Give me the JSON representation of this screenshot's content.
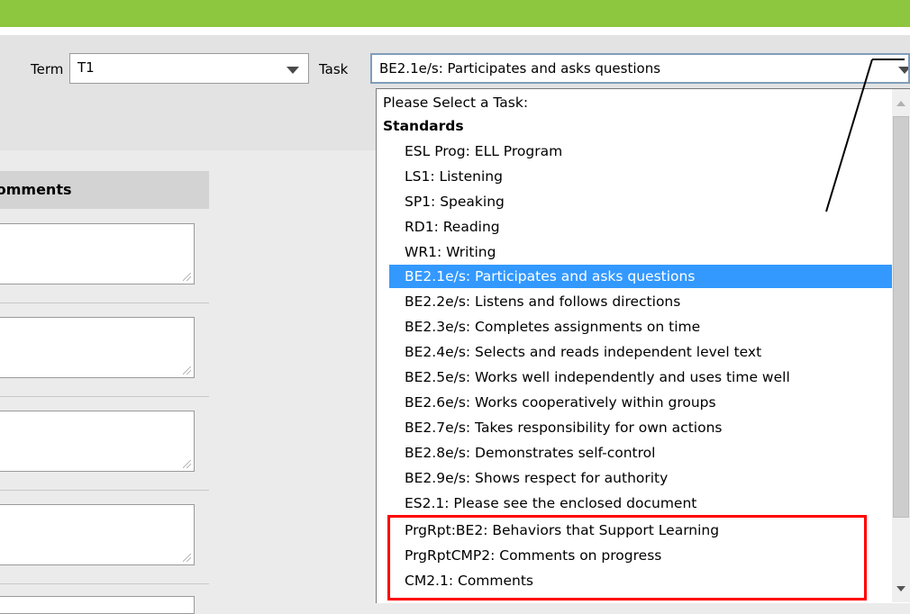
{
  "filters": {
    "term_label": "Term",
    "term_value": "T1",
    "task_label": "Task",
    "task_value": "BE2.1e/s: Participates and asks questions"
  },
  "comments": {
    "header": "Comments"
  },
  "dropdown": {
    "placeholder": "Please Select a Task:",
    "group": "Standards",
    "items": [
      "ESL Prog: ELL Program",
      "LS1: Listening",
      "SP1: Speaking",
      "RD1: Reading",
      "WR1: Writing",
      "BE2.1e/s: Participates and asks questions",
      "BE2.2e/s: Listens and follows directions",
      "BE2.3e/s: Completes assignments on time",
      "BE2.4e/s: Selects and reads independent level text",
      "BE2.5e/s: Works well independently and uses time well",
      "BE2.6e/s: Works cooperatively within groups",
      "BE2.7e/s: Takes responsibility for own actions",
      "BE2.8e/s: Demonstrates self-control",
      "BE2.9e/s: Shows respect for authority",
      "ES2.1: Please see the enclosed document",
      "PrgRpt:BE2: Behaviors that Support Learning",
      "PrgRptCMP2: Comments on progress",
      "CM2.1: Comments"
    ],
    "selected_index": 5
  },
  "colors": {
    "topbar": "#8dc63f",
    "selection": "#3399ff",
    "highlight_box": "#ff0000"
  },
  "icons": {
    "dropdown_arrow": "chevron-down-icon",
    "resize_grip": "resize-grip-icon"
  }
}
